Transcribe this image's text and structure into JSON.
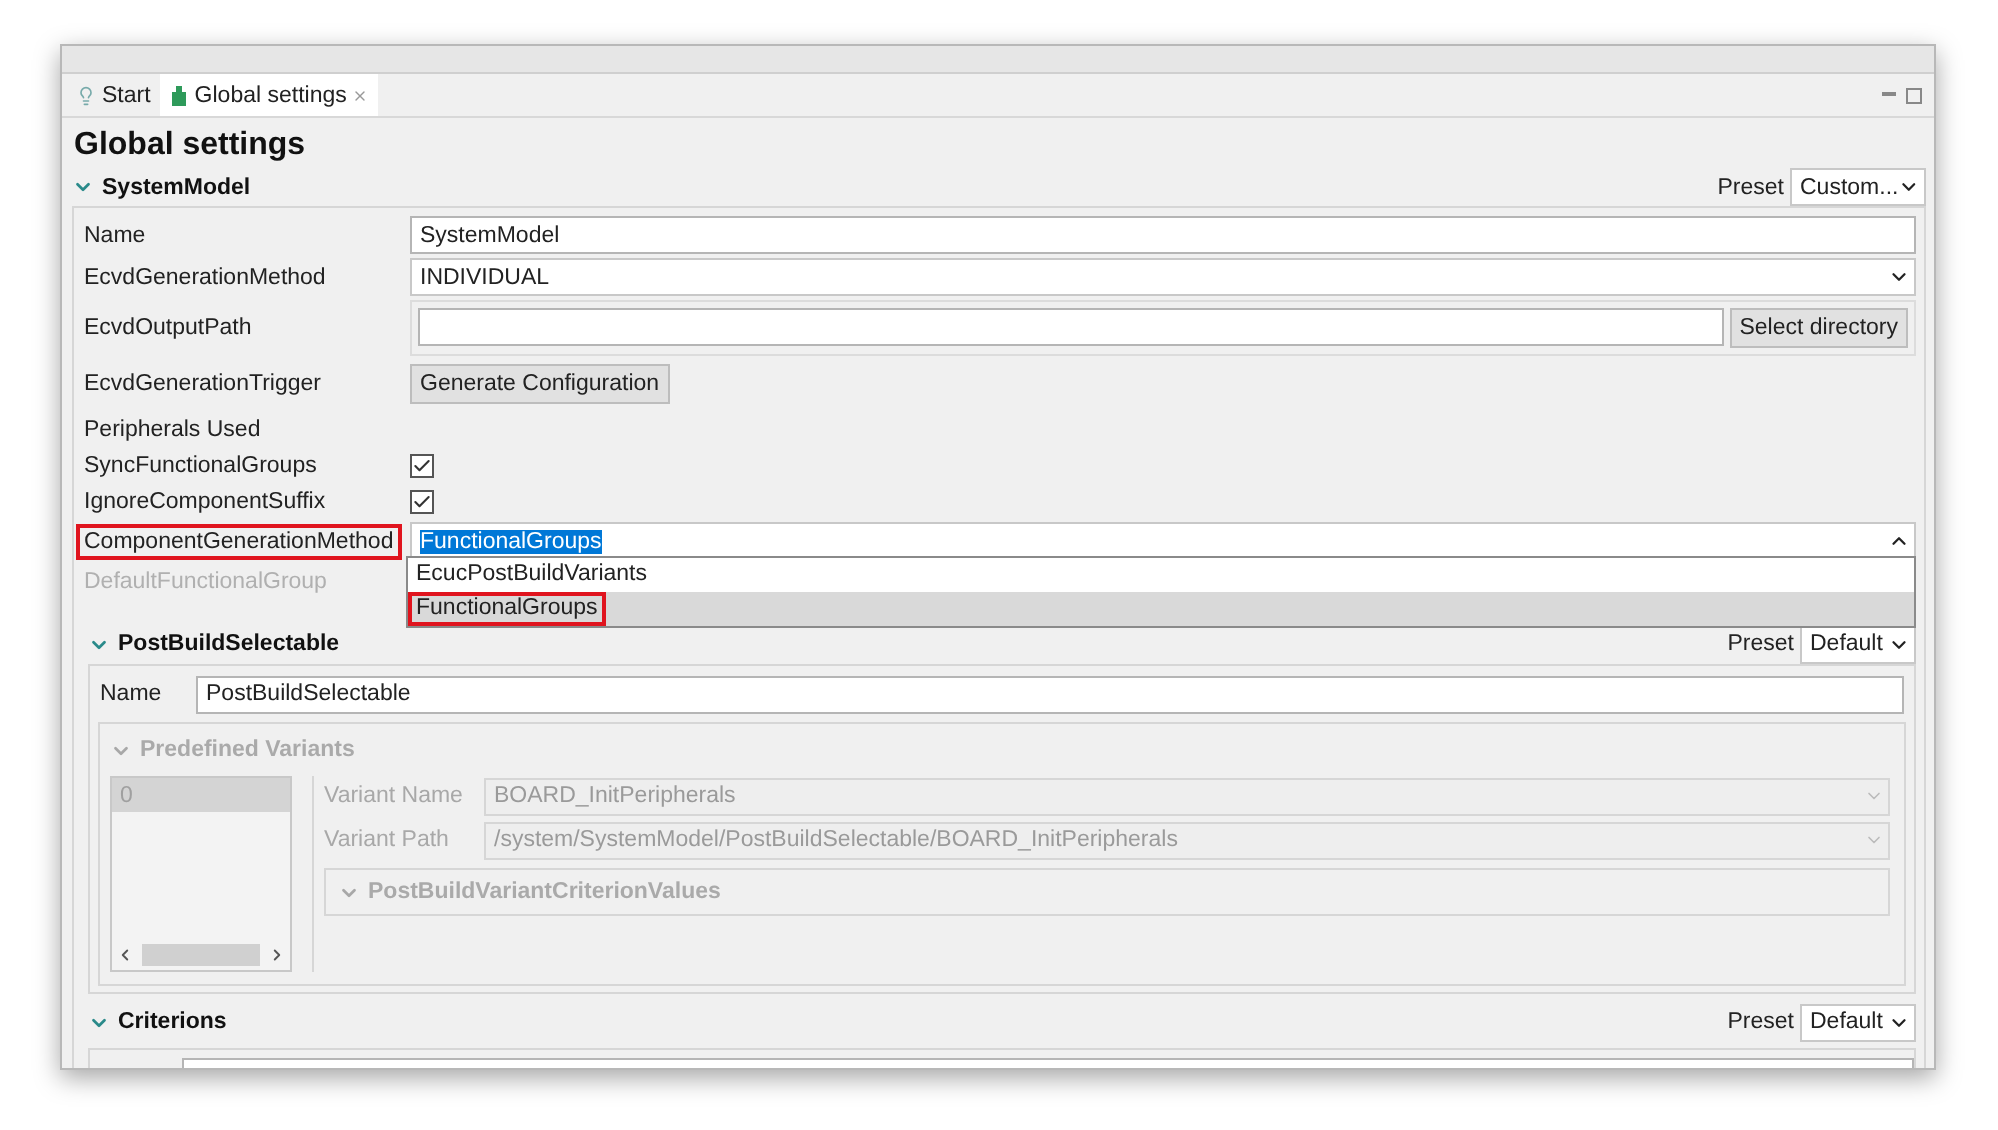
{
  "tabs": [
    {
      "label": "Start",
      "selected": false
    },
    {
      "label": "Global settings",
      "selected": true
    }
  ],
  "title": "Global settings",
  "system_model": {
    "title": "SystemModel",
    "expanded": true,
    "preset_label": "Preset",
    "preset": "Custom...",
    "fields": [
      {
        "kind": "text",
        "label": "Name",
        "value": "SystemModel"
      },
      {
        "kind": "combo",
        "label": "EcvdGenerationMethod",
        "value": "INDIVIDUAL"
      },
      {
        "kind": "path",
        "label": "EcvdOutputPath",
        "button": "Select directory"
      },
      {
        "kind": "button",
        "label": "EcvdGenerationTrigger",
        "button": "Generate Configuration"
      },
      {
        "kind": "heading",
        "label": "Peripherals Used"
      },
      {
        "kind": "checkbox",
        "label": "SyncFunctionalGroups",
        "checked": true
      },
      {
        "kind": "checkbox",
        "label": "IgnoreComponentSuffix",
        "checked": true
      },
      {
        "kind": "combo",
        "label": "ComponentGenerationMethod",
        "value": "FunctionalGroups",
        "text_selected": true,
        "highlighted": true,
        "expanded": true,
        "options": [
          {
            "label": "EcucPostBuildVariants",
            "selected": false,
            "highlighted": false
          },
          {
            "label": "FunctionalGroups",
            "selected": true,
            "highlighted": true
          }
        ]
      },
      {
        "kind": "heading",
        "label": "DefaultFunctionalGroup",
        "disabled": true
      }
    ]
  },
  "post_build": {
    "title": "PostBuildSelectable",
    "expanded": true,
    "preset_label": "Preset",
    "preset": "Default",
    "name_label": "Name",
    "name": "PostBuildSelectable",
    "variants": {
      "title": "Predefined Variants",
      "expanded": true,
      "disabled": true,
      "items": [
        {
          "label": "0",
          "selected": true
        }
      ],
      "fields": [
        {
          "label": "Variant Name",
          "value": "BOARD_InitPeripherals"
        },
        {
          "label": "Variant Path",
          "value": "/system/SystemModel/PostBuildSelectable/BOARD_InitPeripherals"
        }
      ],
      "criterion_values": {
        "title": "PostBuildVariantCriterionValues",
        "expanded": true
      }
    }
  },
  "criterions": {
    "title": "Criterions",
    "expanded": true,
    "preset_label": "Preset",
    "preset": "Default"
  }
}
